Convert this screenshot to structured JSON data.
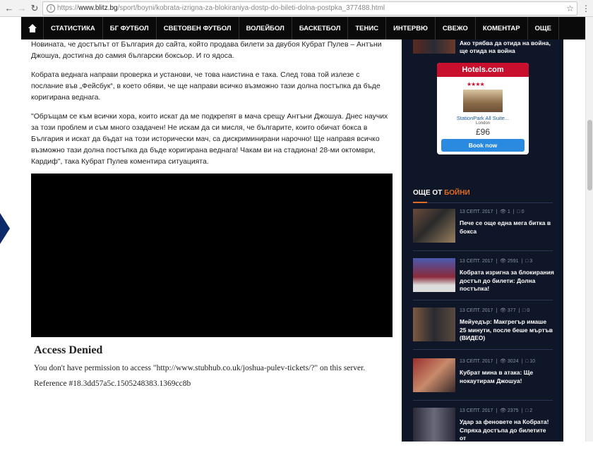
{
  "browser": {
    "url_protocol": "https://",
    "url_host": "www.blitz.bg",
    "url_path": "/sport/boyni/kobrata-izrigna-za-blokiraniya-dostp-do-bileti-dolna-postpka_377488.html"
  },
  "nav": {
    "items": [
      "СТАТИСТИКА",
      "БГ ФУТБОЛ",
      "СВЕТОВЕН ФУТБОЛ",
      "ВОЛЕЙБОЛ",
      "БАСКЕТБОЛ",
      "ТЕНИС",
      "ИНТЕРВЮ",
      "СВЕЖО",
      "КОМЕНТАР",
      "ОЩЕ"
    ]
  },
  "article": {
    "p1": "Новината, че достъпът от България до сайта, който продава билети за двубоя Кубрат Пулев – Антъни Джошуа, достигна до самия български боксьор. И го ядоса.",
    "p2": "Кобрата веднага направи проверка и установи, че това наистина е така. След това той излезе с послание във „Фейсбук“, в което обяви, че ще направи всичко възможно тази долна постъпка да бъде коригирана веднага.",
    "p3": "\"Обръщам се към всички хора, които искат да ме подкрепят в мача срещу Антъни Джошуа. Днес научих за този проблем и съм много озадачен! Не искам да си мисля, че българите, които обичат бокса в България и искат да бъдат на този исторически мач, са дискриминирани нарочно! Ще направя всичко възможно тази долна постъпка да бъде коригирана веднага! Чакам ви на стадиона! 28-ми октомври, Кардиф\", така Кубрат Пулев коментира ситуацията."
  },
  "denied": {
    "title": "Access Denied",
    "message": "You don't have permission to access \"http://www.stubhub.co.uk/joshua-pulev-tickets/?\" on this server.",
    "reference": "Reference #18.3dd57a5c.1505248383.1369cc8b"
  },
  "sidebar": {
    "top_item_title": "Ако трябва да отида на война, ще отида на война",
    "hotels": {
      "brand": "Hotels.com",
      "stars": "★★★★",
      "hotel_name": "StationPark All Suite...",
      "city": "London",
      "price": "£96",
      "cta": "Book now"
    },
    "section_prefix": "ОЩЕ ОТ ",
    "section_accent": "БОЙНИ",
    "news": [
      {
        "date": "13 СЕПТ. 2017",
        "views": "1",
        "comments": "0",
        "headline": "Пече се още една мега битка в бокса"
      },
      {
        "date": "13 СЕПТ. 2017",
        "views": "2591",
        "comments": "3",
        "headline": "Кобрата изригна за блокирания достъп до билети: Долна постъпка!"
      },
      {
        "date": "13 СЕПТ. 2017",
        "views": "377",
        "comments": "0",
        "headline": "Мейуедър: Макгрегър имаше 25 минути, после беше мъртъв (ВИДЕО)"
      },
      {
        "date": "13 СЕПТ. 2017",
        "views": "3024",
        "comments": "10",
        "headline": "Кубрат мина в атака: Ще нокаутирам Джошуа!"
      },
      {
        "date": "13 СЕПТ. 2017",
        "views": "2375",
        "comments": "2",
        "headline": "Удар за феновете на Кобрата! Спряха достъпа до билетите от"
      }
    ]
  },
  "colors": {
    "nav_bg": "#0a0a0a",
    "sidebar_bg": "#0f1627",
    "accent": "#e06b24",
    "hotels_red": "#c8102e",
    "book_blue": "#2a8ae0"
  }
}
